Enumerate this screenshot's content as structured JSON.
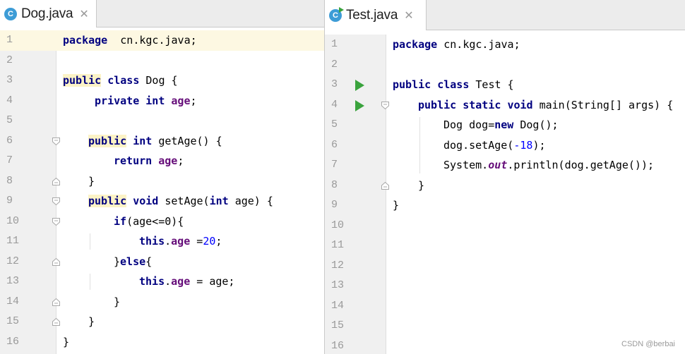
{
  "left_pane": {
    "tab": {
      "icon_letter": "C",
      "title": "Dog.java",
      "close": "✕"
    },
    "lines": [
      {
        "n": "1",
        "tokens": [
          [
            "kw",
            "package"
          ],
          [
            "",
            "  cn.kgc.java;"
          ]
        ]
      },
      {
        "n": "2",
        "tokens": []
      },
      {
        "n": "3",
        "tokens": [
          [
            "kw hl",
            "public"
          ],
          [
            "",
            " "
          ],
          [
            "kw",
            "class"
          ],
          [
            "",
            " Dog {"
          ]
        ]
      },
      {
        "n": "4",
        "tokens": [
          [
            "",
            " "
          ],
          [
            "kw",
            "private"
          ],
          [
            "",
            " "
          ],
          [
            "kw",
            "int"
          ],
          [
            "",
            " "
          ],
          [
            "fld",
            "age"
          ],
          [
            "",
            ";"
          ]
        ]
      },
      {
        "n": "5",
        "tokens": []
      },
      {
        "n": "6",
        "tokens": [
          [
            "kw hl",
            "public"
          ],
          [
            "",
            " "
          ],
          [
            "kw",
            "int"
          ],
          [
            "",
            " getAge() {"
          ]
        ]
      },
      {
        "n": "7",
        "tokens": [
          [
            "kw",
            "return"
          ],
          [
            "",
            " "
          ],
          [
            "fld",
            "age"
          ],
          [
            "",
            ";"
          ]
        ]
      },
      {
        "n": "8",
        "tokens": [
          [
            "",
            "}"
          ]
        ]
      },
      {
        "n": "9",
        "tokens": [
          [
            "kw hl",
            "public"
          ],
          [
            "",
            " "
          ],
          [
            "kw",
            "void"
          ],
          [
            "",
            " setAge("
          ],
          [
            "kw",
            "int"
          ],
          [
            "",
            " age) {"
          ]
        ]
      },
      {
        "n": "10",
        "tokens": [
          [
            "kw",
            "if"
          ],
          [
            "",
            "(age<=0){"
          ]
        ]
      },
      {
        "n": "11",
        "tokens": [
          [
            "kw",
            "this"
          ],
          [
            "",
            "."
          ],
          [
            "fld",
            "age"
          ],
          [
            "",
            " ="
          ],
          [
            "num",
            "20"
          ],
          [
            "",
            ";"
          ]
        ]
      },
      {
        "n": "12",
        "tokens": [
          [
            "",
            "}"
          ],
          [
            "kw",
            "else"
          ],
          [
            "",
            "{"
          ]
        ]
      },
      {
        "n": "13",
        "tokens": [
          [
            "kw",
            "this"
          ],
          [
            "",
            "."
          ],
          [
            "fld",
            "age"
          ],
          [
            "",
            " = age;"
          ]
        ]
      },
      {
        "n": "14",
        "tokens": [
          [
            "",
            "}"
          ]
        ]
      },
      {
        "n": "15",
        "tokens": [
          [
            "",
            "}"
          ]
        ]
      },
      {
        "n": "16",
        "tokens": [
          [
            "",
            "}"
          ]
        ]
      }
    ]
  },
  "right_pane": {
    "tab": {
      "icon_letter": "C",
      "title": "Test.java",
      "close": "✕"
    },
    "lines": [
      {
        "n": "1",
        "tokens": [
          [
            "kw",
            "package"
          ],
          [
            "",
            " cn.kgc.java;"
          ]
        ]
      },
      {
        "n": "2",
        "tokens": []
      },
      {
        "n": "3",
        "tokens": [
          [
            "kw",
            "public"
          ],
          [
            "",
            " "
          ],
          [
            "kw",
            "class"
          ],
          [
            "",
            " Test {"
          ]
        ]
      },
      {
        "n": "4",
        "tokens": [
          [
            "kw",
            "public"
          ],
          [
            "",
            " "
          ],
          [
            "kw",
            "static"
          ],
          [
            "",
            " "
          ],
          [
            "kw",
            "void"
          ],
          [
            "",
            " main(String[] args) {"
          ]
        ]
      },
      {
        "n": "5",
        "tokens": [
          [
            "",
            "Dog dog="
          ],
          [
            "kw",
            "new"
          ],
          [
            "",
            " Dog();"
          ]
        ]
      },
      {
        "n": "6",
        "tokens": [
          [
            "",
            "dog.setAge("
          ],
          [
            "num",
            "-18"
          ],
          [
            "",
            ");"
          ]
        ]
      },
      {
        "n": "7",
        "tokens": [
          [
            "",
            "System."
          ],
          [
            "stat",
            "out"
          ],
          [
            "",
            ".println(dog.getAge());"
          ]
        ]
      },
      {
        "n": "8",
        "tokens": [
          [
            "",
            "}"
          ]
        ]
      },
      {
        "n": "9",
        "tokens": [
          [
            "",
            "}"
          ]
        ]
      },
      {
        "n": "10",
        "tokens": []
      },
      {
        "n": "11",
        "tokens": []
      },
      {
        "n": "12",
        "tokens": []
      },
      {
        "n": "13",
        "tokens": []
      },
      {
        "n": "14",
        "tokens": []
      },
      {
        "n": "15",
        "tokens": []
      },
      {
        "n": "16",
        "tokens": []
      }
    ]
  },
  "watermark": "CSDN @berbai",
  "colors": {
    "keyword": "#000080",
    "field": "#660e7a",
    "number": "#0000ff",
    "gutter_bg": "#f0f0f0",
    "current_line": "#fdf8e2",
    "run_icon": "#3aa33d",
    "class_icon": "#3d9cd6"
  },
  "icons": {
    "class_file": "class-file-icon",
    "run_gutter": "run-gutter-icon",
    "fold_open": "fold-open-icon",
    "fold_close": "fold-close-icon"
  }
}
